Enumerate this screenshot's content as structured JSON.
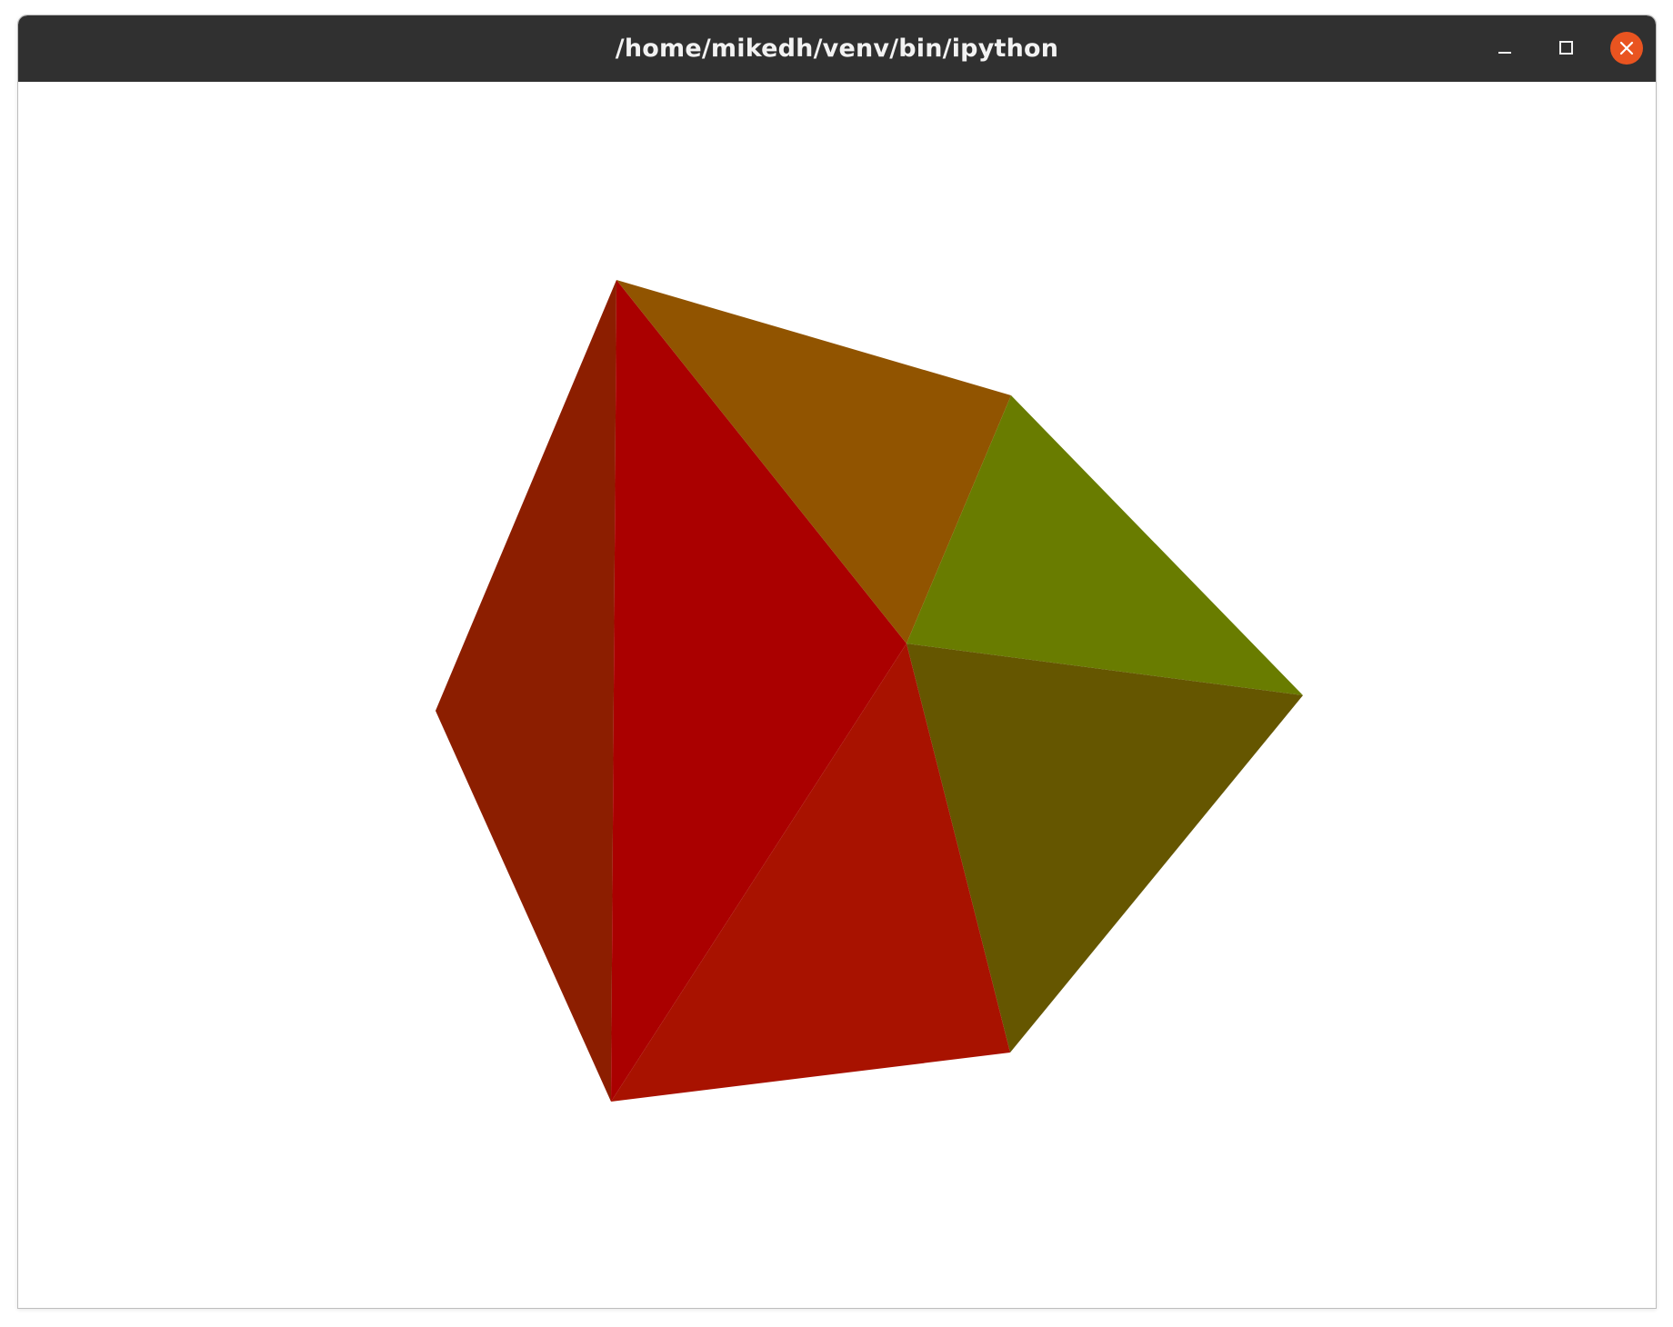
{
  "window": {
    "title": "/home/mikedh/venv/bin/ipython",
    "titlebar_color": "#303030",
    "close_button_color": "#e95420"
  },
  "controls": {
    "minimize_icon": "minimize-icon",
    "maximize_icon": "maximize-icon",
    "close_icon": "close-icon"
  },
  "scene": {
    "background": "#ffffff",
    "object": "polyhedron",
    "face_colors": [
      "#8c1e00",
      "#aa0000",
      "#915400",
      "#697c00",
      "#655600",
      "#a81200"
    ]
  }
}
